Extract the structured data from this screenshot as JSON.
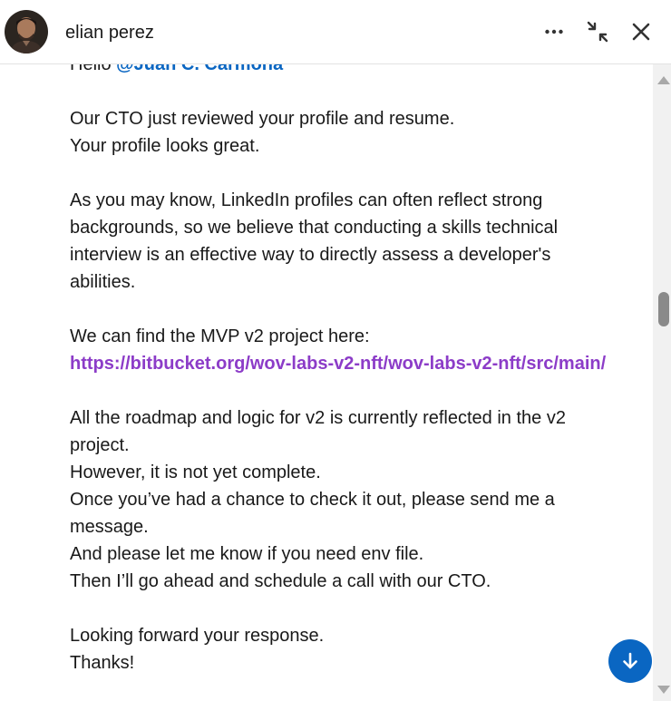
{
  "header": {
    "contact_name": "elian perez",
    "avatar_icon": "person-avatar",
    "more_icon": "more-options-icon",
    "collapse_icon": "collapse-arrows-icon",
    "close_icon": "close-icon"
  },
  "message": {
    "greeting_prefix": "Hello",
    "mention": "@Juan C. Carmona",
    "para1_line1": "Our CTO just reviewed your profile and resume.",
    "para1_line2": "Your profile looks great.",
    "para2": "As you may know, LinkedIn profiles can often reflect strong backgrounds, so we believe that conducting a skills technical interview is an effective way to directly assess a developer's abilities.",
    "para3_intro": "We can find the MVP v2 project here:",
    "project_link": "https://bitbucket.org/wov-labs-v2-nft/wov-labs-v2-nft/src/main/",
    "para4_line1": "All the roadmap and logic for v2 is currently reflected in the v2 project.",
    "para4_line2": "However, it is not yet complete.",
    "para4_line3": "Once you’ve had a chance to check it out, please send me a message.",
    "para4_line4": "And please let me know if you need env file.",
    "para4_line5": "Then I’ll go ahead and schedule a call with our CTO.",
    "closing_line1": "Looking forward your response.",
    "closing_line2": "Thanks!"
  },
  "jump_button_icon": "arrow-down-icon",
  "colors": {
    "accent": "#0a66c2",
    "link_visited": "#8c3cc8",
    "text": "#191919"
  }
}
